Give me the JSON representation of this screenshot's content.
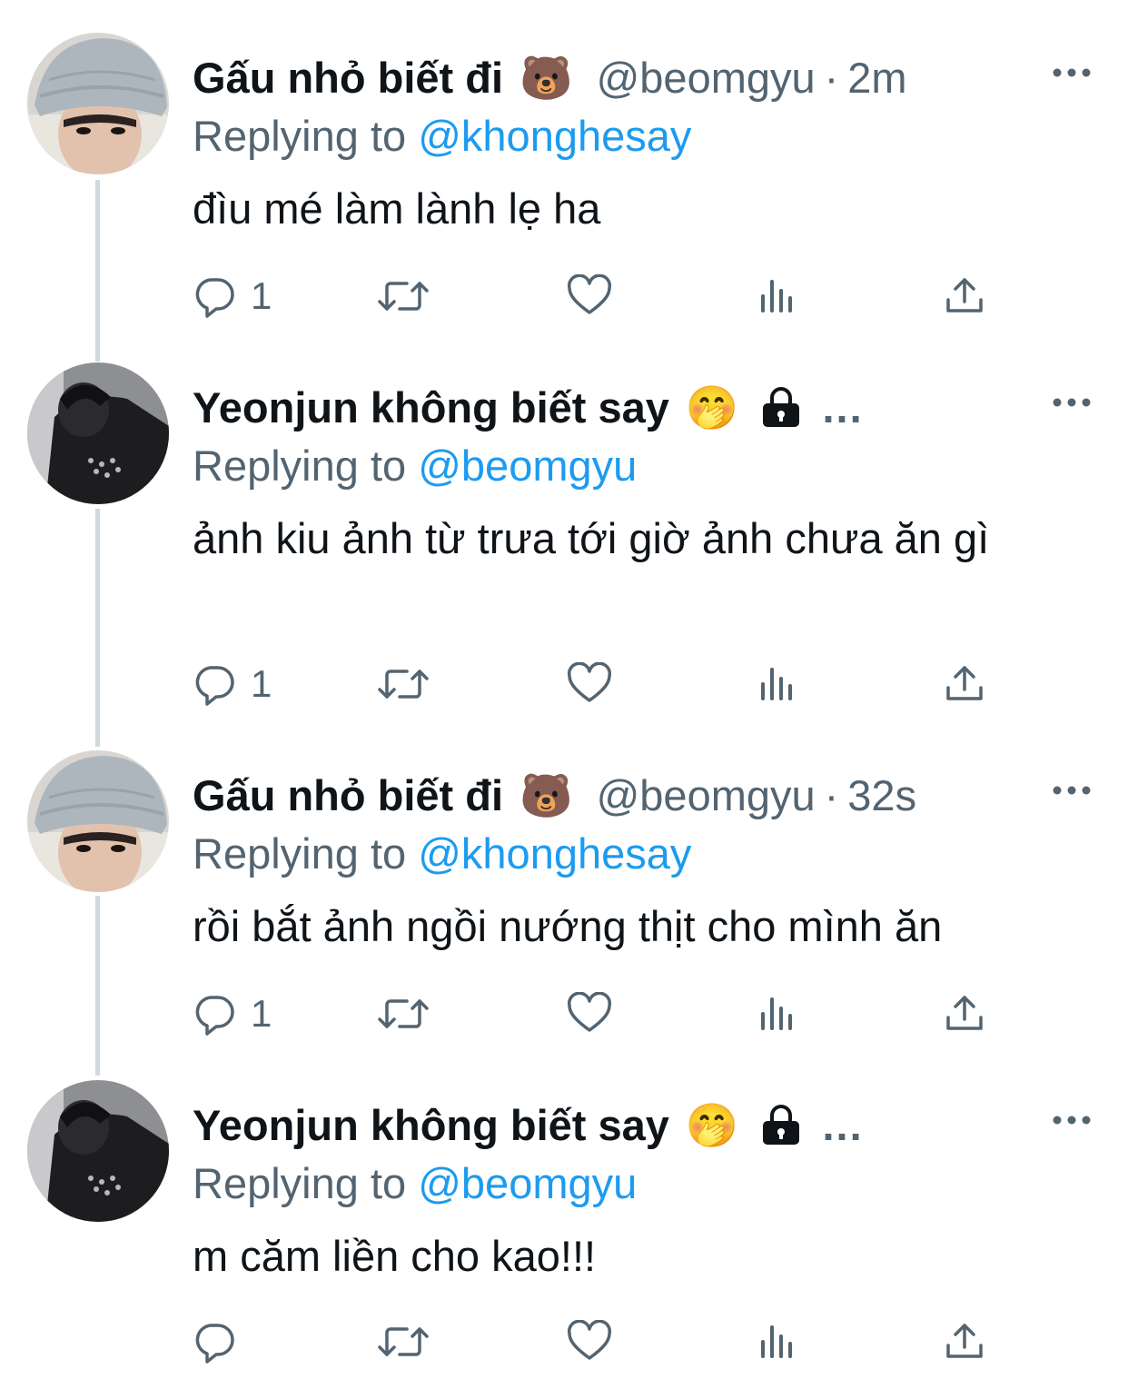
{
  "tweets": [
    {
      "display_name": "Gấu nhỏ biết đi",
      "name_emoji": "🐻",
      "handle": "@beomgyu",
      "separator": "·",
      "time": "2m",
      "replying_label": "Replying to",
      "replying_to": "@khonghesay",
      "text": "đìu mé làm lành lẹ ha",
      "reply_count": "1",
      "avatar_icon": "avatar-beanie-photo"
    },
    {
      "display_name": "Yeonjun không biết say",
      "name_emoji": "🤭",
      "lock_icon": "lock-icon",
      "truncation": "...",
      "replying_label": "Replying to",
      "replying_to": "@beomgyu",
      "text": "ảnh kiu ảnh từ trưa tới giờ ảnh chưa ăn gì",
      "reply_count": "1",
      "avatar_icon": "avatar-dark-photo"
    },
    {
      "display_name": "Gấu nhỏ biết đi",
      "name_emoji": "🐻",
      "handle": "@beomgyu",
      "separator": "·",
      "time": "32s",
      "replying_label": "Replying to",
      "replying_to": "@khonghesay",
      "text": "rồi bắt ảnh ngồi nướng thịt cho mình ăn",
      "reply_count": "1",
      "avatar_icon": "avatar-beanie-photo"
    },
    {
      "display_name": "Yeonjun không biết say",
      "name_emoji": "🤭",
      "lock_icon": "lock-icon",
      "truncation": "...",
      "replying_label": "Replying to",
      "replying_to": "@beomgyu",
      "text": "m căm liền cho kao!!!",
      "reply_count": "",
      "avatar_icon": "avatar-dark-photo"
    }
  ],
  "colors": {
    "text_primary": "#0f1419",
    "text_secondary": "#536471",
    "link": "#1d9bf0",
    "thread_line": "#cfd9de"
  },
  "action_icons": [
    "reply-icon",
    "retweet-icon",
    "like-icon",
    "views-icon",
    "share-icon"
  ]
}
